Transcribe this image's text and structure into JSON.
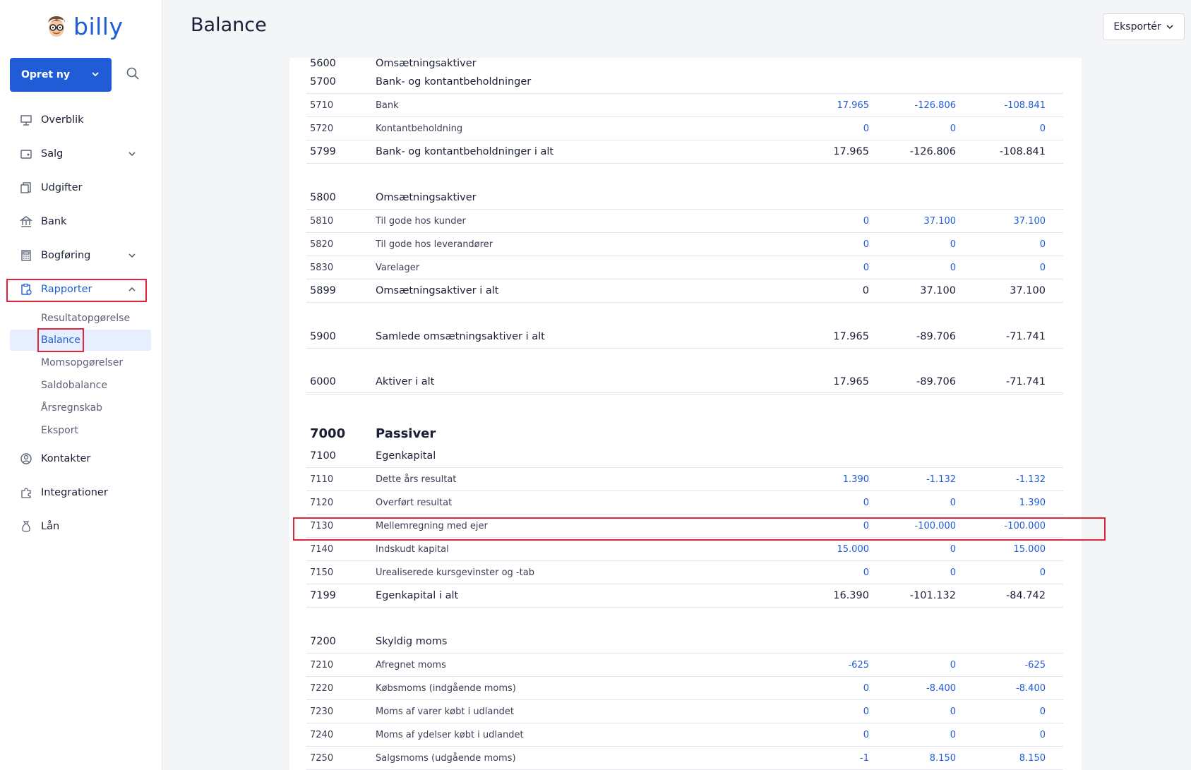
{
  "app": {
    "logo_text": "billy"
  },
  "sidebar": {
    "create_label": "Opret ny",
    "items": [
      {
        "label": "Overblik"
      },
      {
        "label": "Salg"
      },
      {
        "label": "Udgifter"
      },
      {
        "label": "Bank"
      },
      {
        "label": "Bogføring"
      },
      {
        "label": "Rapporter"
      },
      {
        "label": "Kontakter"
      },
      {
        "label": "Integrationer"
      },
      {
        "label": "Lån"
      }
    ],
    "sub_items": [
      {
        "label": "Resultatopgørelse"
      },
      {
        "label": "Balance"
      },
      {
        "label": "Momsopgørelser"
      },
      {
        "label": "Saldobalance"
      },
      {
        "label": "Årsregnskab"
      },
      {
        "label": "Eksport"
      }
    ]
  },
  "header": {
    "title": "Balance",
    "export_label": "Eksportér"
  },
  "rows": [
    {
      "acc": "5600",
      "name": "Omsætningsaktiver",
      "v1": "",
      "v2": "",
      "v3": ""
    },
    {
      "acc": "5700",
      "name": "Bank- og kontantbeholdninger",
      "v1": "",
      "v2": "",
      "v3": ""
    },
    {
      "acc": "5710",
      "name": "Bank",
      "v1": "17.965",
      "v2": "-126.806",
      "v3": "-108.841"
    },
    {
      "acc": "5720",
      "name": "Kontantbeholdning",
      "v1": "0",
      "v2": "0",
      "v3": "0"
    },
    {
      "acc": "5799",
      "name": "Bank- og kontantbeholdninger i alt",
      "v1": "17.965",
      "v2": "-126.806",
      "v3": "-108.841"
    },
    {
      "acc": "5800",
      "name": "Omsætningsaktiver",
      "v1": "",
      "v2": "",
      "v3": ""
    },
    {
      "acc": "5810",
      "name": "Til gode hos kunder",
      "v1": "0",
      "v2": "37.100",
      "v3": "37.100"
    },
    {
      "acc": "5820",
      "name": "Til gode hos leverandører",
      "v1": "0",
      "v2": "0",
      "v3": "0"
    },
    {
      "acc": "5830",
      "name": "Varelager",
      "v1": "0",
      "v2": "0",
      "v3": "0"
    },
    {
      "acc": "5899",
      "name": "Omsætningsaktiver i alt",
      "v1": "0",
      "v2": "37.100",
      "v3": "37.100"
    },
    {
      "acc": "5900",
      "name": "Samlede omsætningsaktiver i alt",
      "v1": "17.965",
      "v2": "-89.706",
      "v3": "-71.741"
    },
    {
      "acc": "6000",
      "name": "Aktiver i alt",
      "v1": "17.965",
      "v2": "-89.706",
      "v3": "-71.741"
    },
    {
      "acc": "7000",
      "name": "Passiver",
      "v1": "",
      "v2": "",
      "v3": ""
    },
    {
      "acc": "7100",
      "name": "Egenkapital",
      "v1": "",
      "v2": "",
      "v3": ""
    },
    {
      "acc": "7110",
      "name": "Dette års resultat",
      "v1": "1.390",
      "v2": "-1.132",
      "v3": "-1.132"
    },
    {
      "acc": "7120",
      "name": "Overført resultat",
      "v1": "0",
      "v2": "0",
      "v3": "1.390"
    },
    {
      "acc": "7130",
      "name": "Mellemregning med ejer",
      "v1": "0",
      "v2": "-100.000",
      "v3": "-100.000"
    },
    {
      "acc": "7140",
      "name": "Indskudt kapital",
      "v1": "15.000",
      "v2": "0",
      "v3": "15.000"
    },
    {
      "acc": "7150",
      "name": "Urealiserede kursgevinster og -tab",
      "v1": "0",
      "v2": "0",
      "v3": "0"
    },
    {
      "acc": "7199",
      "name": "Egenkapital i alt",
      "v1": "16.390",
      "v2": "-101.132",
      "v3": "-84.742"
    },
    {
      "acc": "7200",
      "name": "Skyldig moms",
      "v1": "",
      "v2": "",
      "v3": ""
    },
    {
      "acc": "7210",
      "name": "Afregnet moms",
      "v1": "-625",
      "v2": "0",
      "v3": "-625"
    },
    {
      "acc": "7220",
      "name": "Købsmoms (indgående moms)",
      "v1": "0",
      "v2": "-8.400",
      "v3": "-8.400"
    },
    {
      "acc": "7230",
      "name": "Moms af varer købt i udlandet",
      "v1": "0",
      "v2": "0",
      "v3": "0"
    },
    {
      "acc": "7240",
      "name": "Moms af ydelser købt i udlandet",
      "v1": "0",
      "v2": "0",
      "v3": "0"
    },
    {
      "acc": "7250",
      "name": "Salgsmoms (udgående moms)",
      "v1": "-1",
      "v2": "8.150",
      "v3": "8.150"
    }
  ],
  "colors": {
    "accent": "#1f5cd6",
    "highlight": "#e0243c"
  }
}
